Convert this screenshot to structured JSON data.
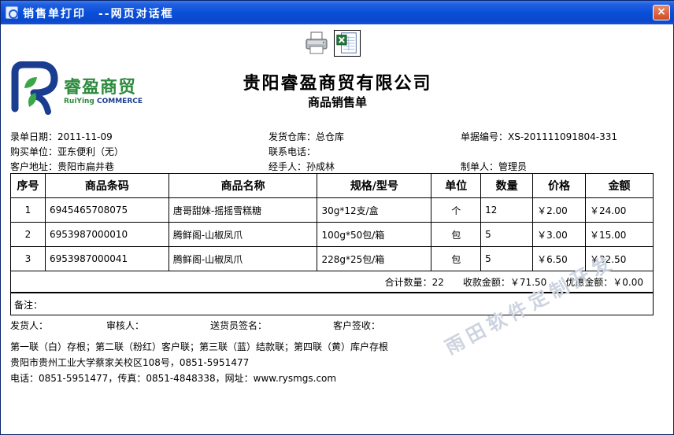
{
  "window": {
    "title": "销售单打印　--网页对话框",
    "close_label": "×"
  },
  "logo": {
    "name_cn": "睿盈商贸",
    "name_en_part1": "RuiYing ",
    "name_en_part2": "COMMERCE"
  },
  "header": {
    "company": "贵阳睿盈商贸有限公司",
    "doc_title": "商品销售单"
  },
  "info": {
    "entry_date": "录单日期：2011-11-09",
    "warehouse": "发货仓库：总仓库",
    "doc_no": "单据编号：XS-201111091804-331",
    "buyer": "购买单位：亚东便利（无）",
    "phone": "联系电话：",
    "address": "客户地址：贵阳市扁井巷",
    "handler": "经手人：孙成林",
    "creator": "制单人：管理员"
  },
  "table": {
    "headers": [
      "序号",
      "商品条码",
      "商品名称",
      "规格/型号",
      "单位",
      "数量",
      "价格",
      "金额"
    ],
    "rows": [
      [
        "1",
        "6945465708075",
        "唐哥甜妹-摇摇雪糕糖",
        "30g*12支/盒",
        "个",
        "12",
        "￥2.00",
        "￥24.00"
      ],
      [
        "2",
        "6953987000010",
        "腾鲜阁-山椒凤爪",
        "100g*50包/箱",
        "包",
        "5",
        "￥3.00",
        "￥15.00"
      ],
      [
        "3",
        "6953987000041",
        "腾鲜阁-山椒凤爪",
        "228g*25包/箱",
        "包",
        "5",
        "￥6.50",
        "￥32.50"
      ]
    ],
    "summary": "合计数量：22　　收款金额：￥71.50　　优惠金额：￥0.00",
    "remark": "备注："
  },
  "signatures": {
    "shipper": "发货人：",
    "reviewer": "审核人：",
    "courier": "送货员签名：",
    "customer": "客户签收："
  },
  "footer": {
    "line1": "第一联（白）存根；第二联（粉红）客户联；第三联（蓝）结款联；第四联（黄）库户存根",
    "line2": "贵阳市贵州工业大学蔡家关校区108号，0851-5951477",
    "line3": "电话：0851-5951477，传真：0851-4848338，网址：www.rysmgs.com"
  },
  "watermark": "雨田软件定制开发",
  "colors": {
    "titlebar": "#0a4fd8",
    "brand_green": "#2e8b3e",
    "brand_blue": "#1a3d8f"
  }
}
